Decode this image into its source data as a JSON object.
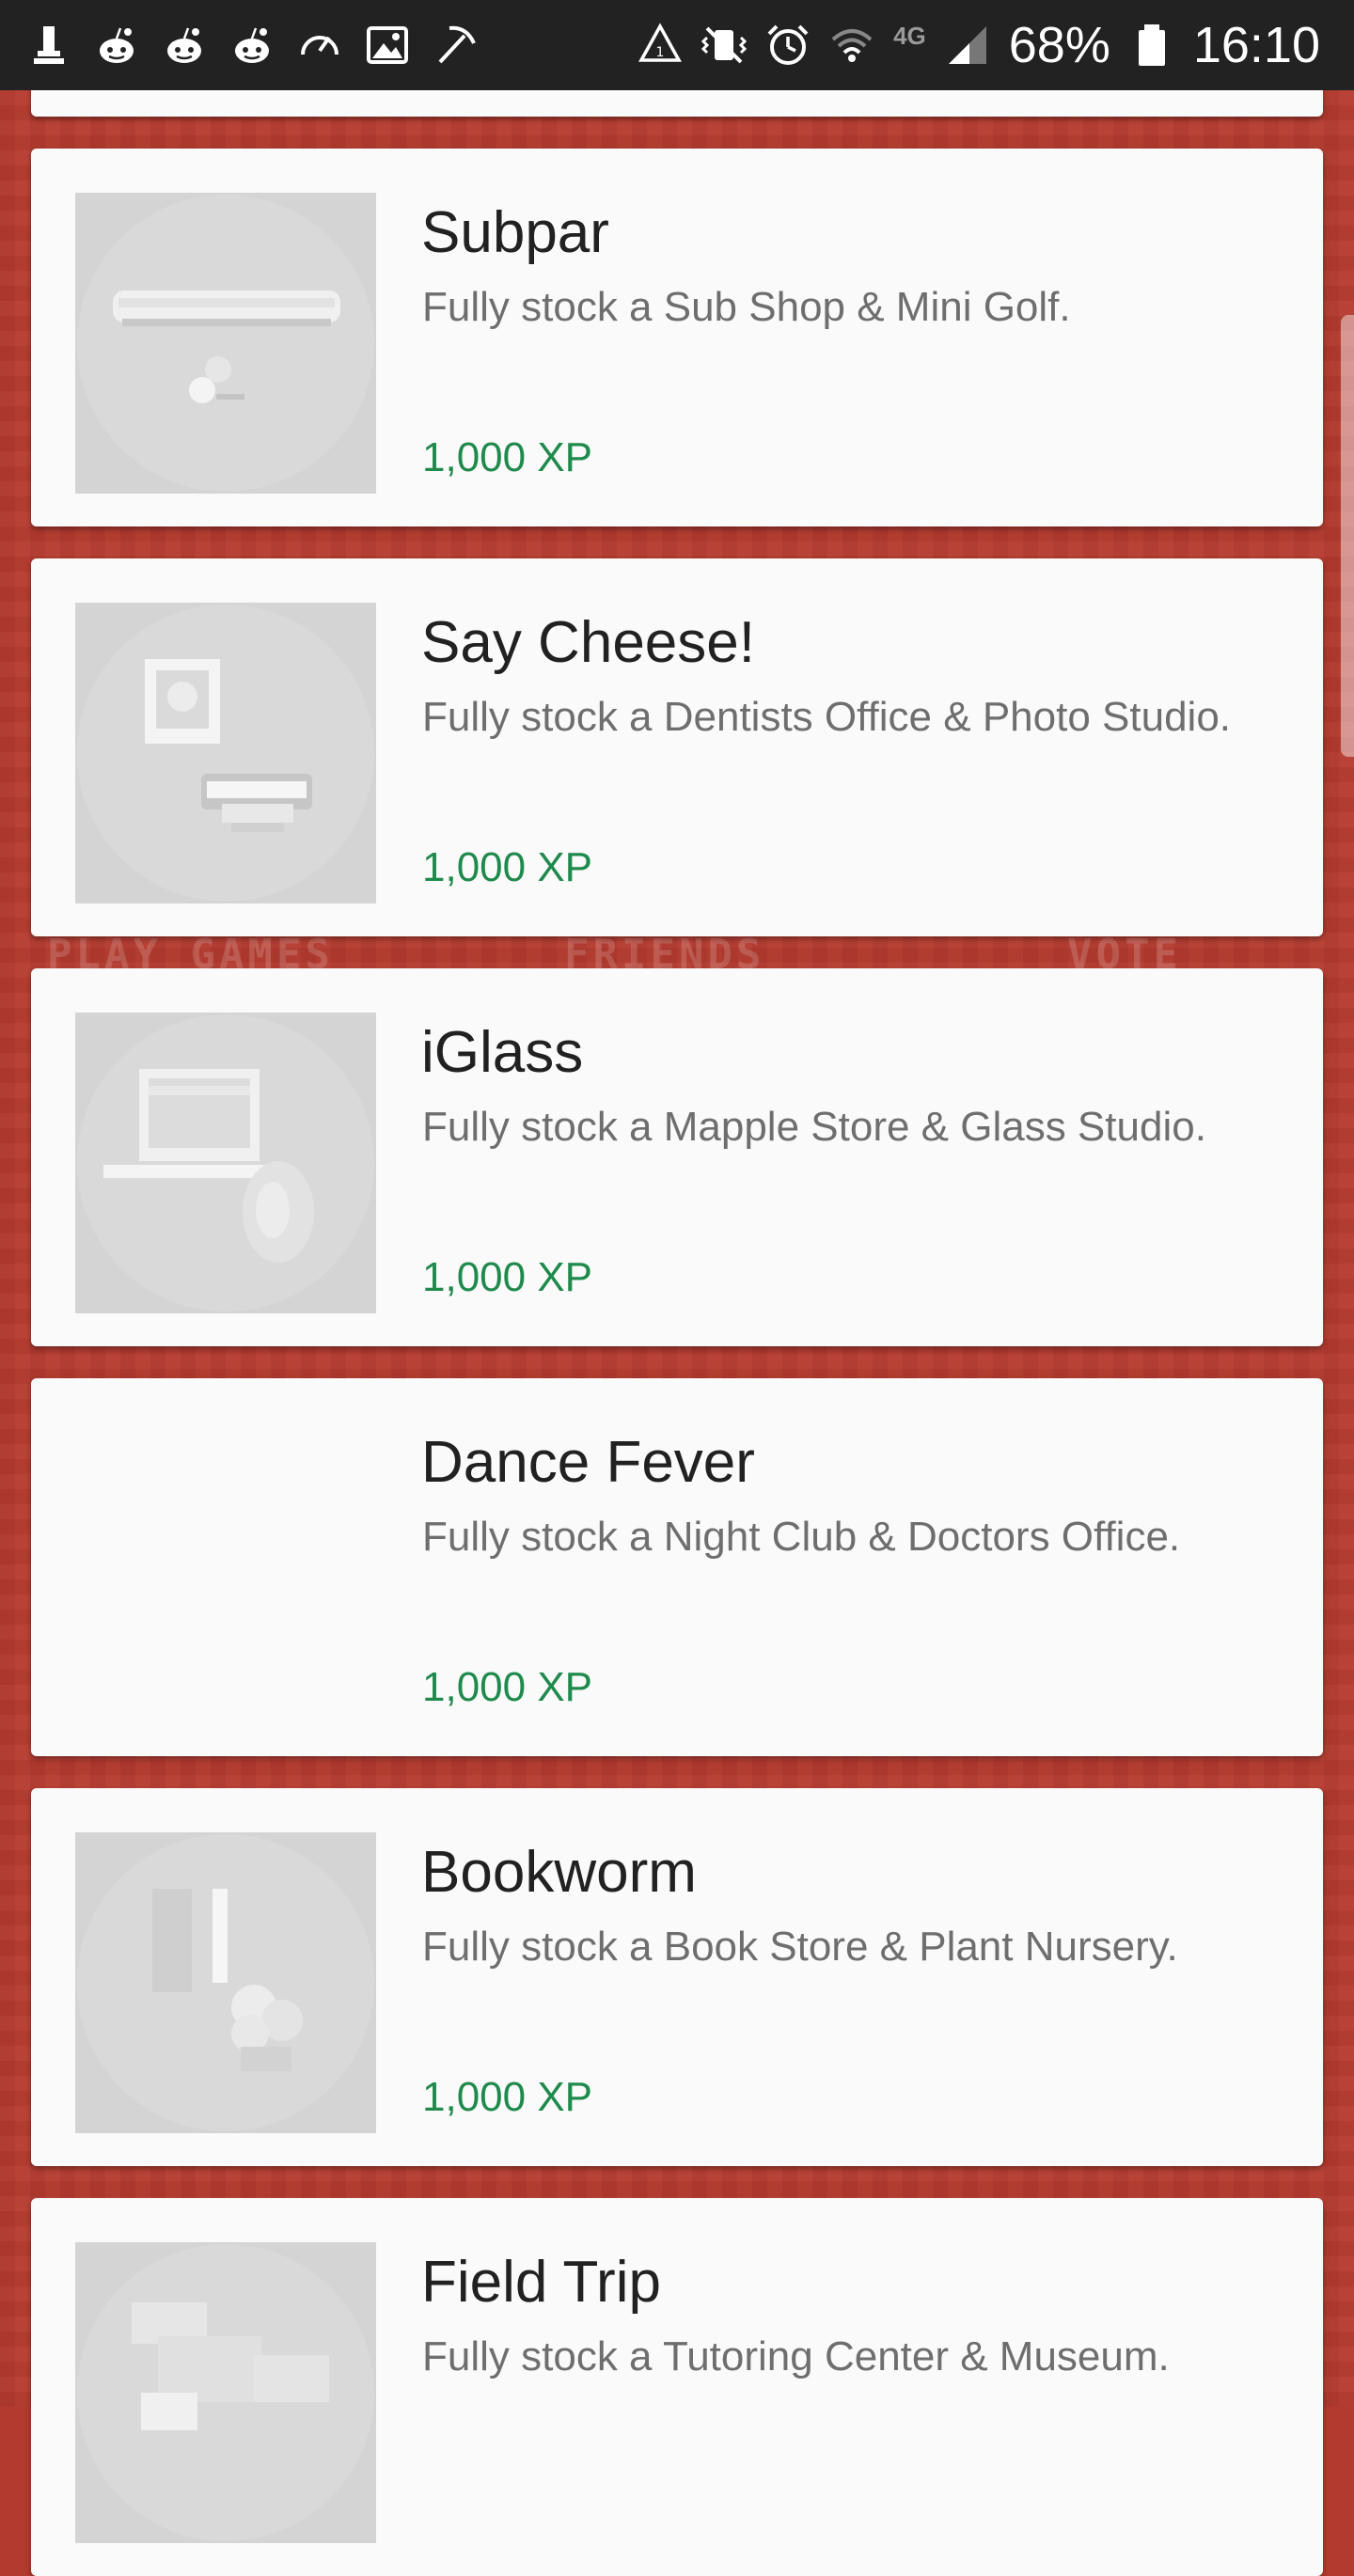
{
  "status_bar": {
    "battery_percent": "68%",
    "time": "16:10",
    "network_label": "4G",
    "left_icons": [
      "usb-tower-icon",
      "reddit-icon",
      "reddit-icon",
      "reddit-icon",
      "speedometer-icon",
      "image-icon",
      "pickaxe-icon"
    ],
    "right_icons": [
      "recycle-warning-icon",
      "vibrate-mute-icon",
      "alarm-icon",
      "wifi-icon",
      "signal-icon",
      "battery-icon"
    ]
  },
  "background": {
    "labels": [
      "PLAY GAMES",
      "FRIENDS",
      "VOTE"
    ],
    "color": "#b63b2f"
  },
  "colors": {
    "xp": "#1f8a4c",
    "title": "#212121",
    "description": "#6e6e6e",
    "card": "#fafafa"
  },
  "achievements": [
    {
      "title": "Subpar",
      "description": "Fully stock a Sub Shop & Mini Golf.",
      "xp": "1,000 XP",
      "icon": "sub-sandwich-golf-icon"
    },
    {
      "title": "Say Cheese!",
      "description": "Fully stock a Dentists Office & Photo Studio.",
      "xp": "1,000 XP",
      "icon": "photo-teeth-icon"
    },
    {
      "title": "iGlass",
      "description": "Fully stock a Mapple Store & Glass Studio.",
      "xp": "1,000 XP",
      "icon": "laptop-glass-icon"
    },
    {
      "title": "Dance Fever",
      "description": "Fully stock a Night Club & Doctors Office.",
      "xp": "1,000 XP",
      "icon": ""
    },
    {
      "title": "Bookworm",
      "description": "Fully stock a Book Store & Plant Nursery.",
      "xp": "1,000 XP",
      "icon": "book-plant-icon"
    },
    {
      "title": "Field Trip",
      "description": "Fully stock a Tutoring Center & Museum.",
      "xp": "",
      "icon": "dinosaur-icon"
    }
  ]
}
